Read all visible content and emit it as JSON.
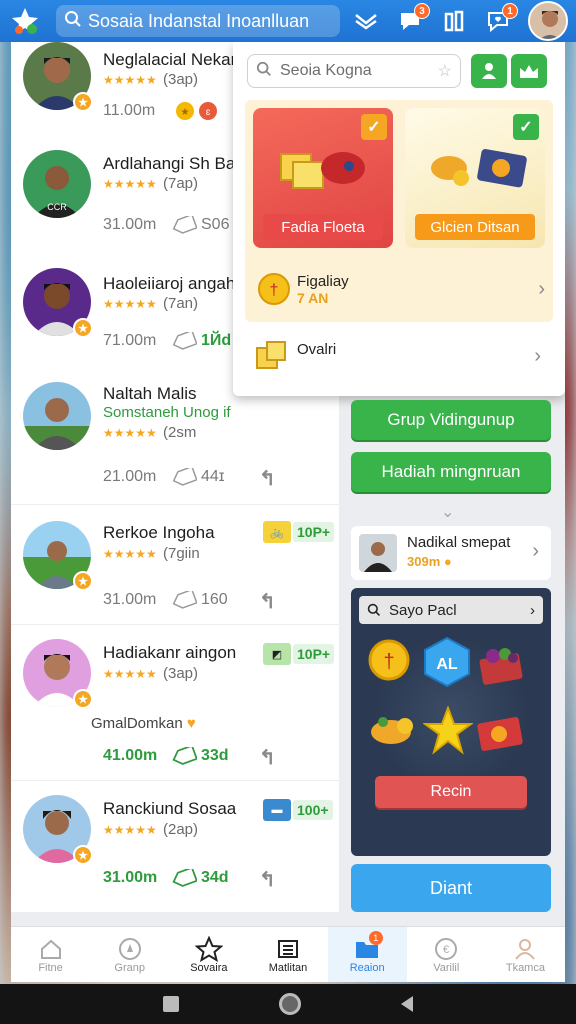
{
  "header": {
    "search_text": "Sosaia Indanstal Inoanlluan",
    "icons": [
      "app-star-logo",
      "search-icon",
      "mail-icon",
      "chat-icon",
      "chart-icon",
      "heart-chat-icon"
    ],
    "badges": {
      "chat": "3",
      "heart_chat": "1"
    }
  },
  "contacts": [
    {
      "name": "Neglalacial Nekans",
      "rating": "(3ap)",
      "distance": "11.00m"
    },
    {
      "name": "Ardlahangi Sh Bak",
      "rating": "(7ap)",
      "distance": "31.00m",
      "count": "S06"
    },
    {
      "name": "Haoleiiaroj angahz",
      "rating": "(7an)",
      "distance": "71.00m",
      "count": "1Йd"
    },
    {
      "name": "Naltah Malis",
      "subname": "Somstaneh Unog if",
      "rating": "(2sm",
      "distance": "21.00m",
      "count": "44ɪ"
    },
    {
      "name": "Rerkoe Ingoha",
      "rating": "(7giin",
      "distance": "31.00m",
      "count": "160",
      "points": "10P+"
    },
    {
      "name": "Hadiakanr aingonlan",
      "rating": "(3ap)",
      "distance": "41.00m",
      "count": "33d",
      "points": "10P+",
      "extra": "GmalDomkan"
    },
    {
      "name": "Ranckiund Sosaak",
      "rating": "(2ap)",
      "distance": "31.00m",
      "count": "34d",
      "points": "100+"
    }
  ],
  "popup": {
    "search_placeholder": "Seoia Kogna",
    "card1_label": "Fadia Floeta",
    "card2_label": "Glcien Ditsan",
    "coin_title": "Figaliay",
    "coin_sub": "7 AN",
    "ovalt_label": "Ovalri"
  },
  "right": {
    "grup_label": "Grup Vidingunup",
    "hadiah_label": "Hadiah mingnruan",
    "profile_name": "Nadikal smepat",
    "profile_sub": "309m",
    "game_search": "Sayo Pacl",
    "game_badge": "AL",
    "recin_label": "Recin",
    "diant_label": "Diant"
  },
  "nav": {
    "items": [
      {
        "label": "Fitne"
      },
      {
        "label": "Granp"
      },
      {
        "label": "Sovaira"
      },
      {
        "label": "Matlitan"
      },
      {
        "label": "Reaion"
      },
      {
        "label": "Varilil"
      },
      {
        "label": "Tkamca"
      }
    ],
    "active_badge": "1"
  },
  "colors": {
    "primary": "#2a86e3",
    "green": "#38b44a",
    "star": "#f5a623",
    "red": "#e05454",
    "blue_button": "#3aa6ee"
  }
}
